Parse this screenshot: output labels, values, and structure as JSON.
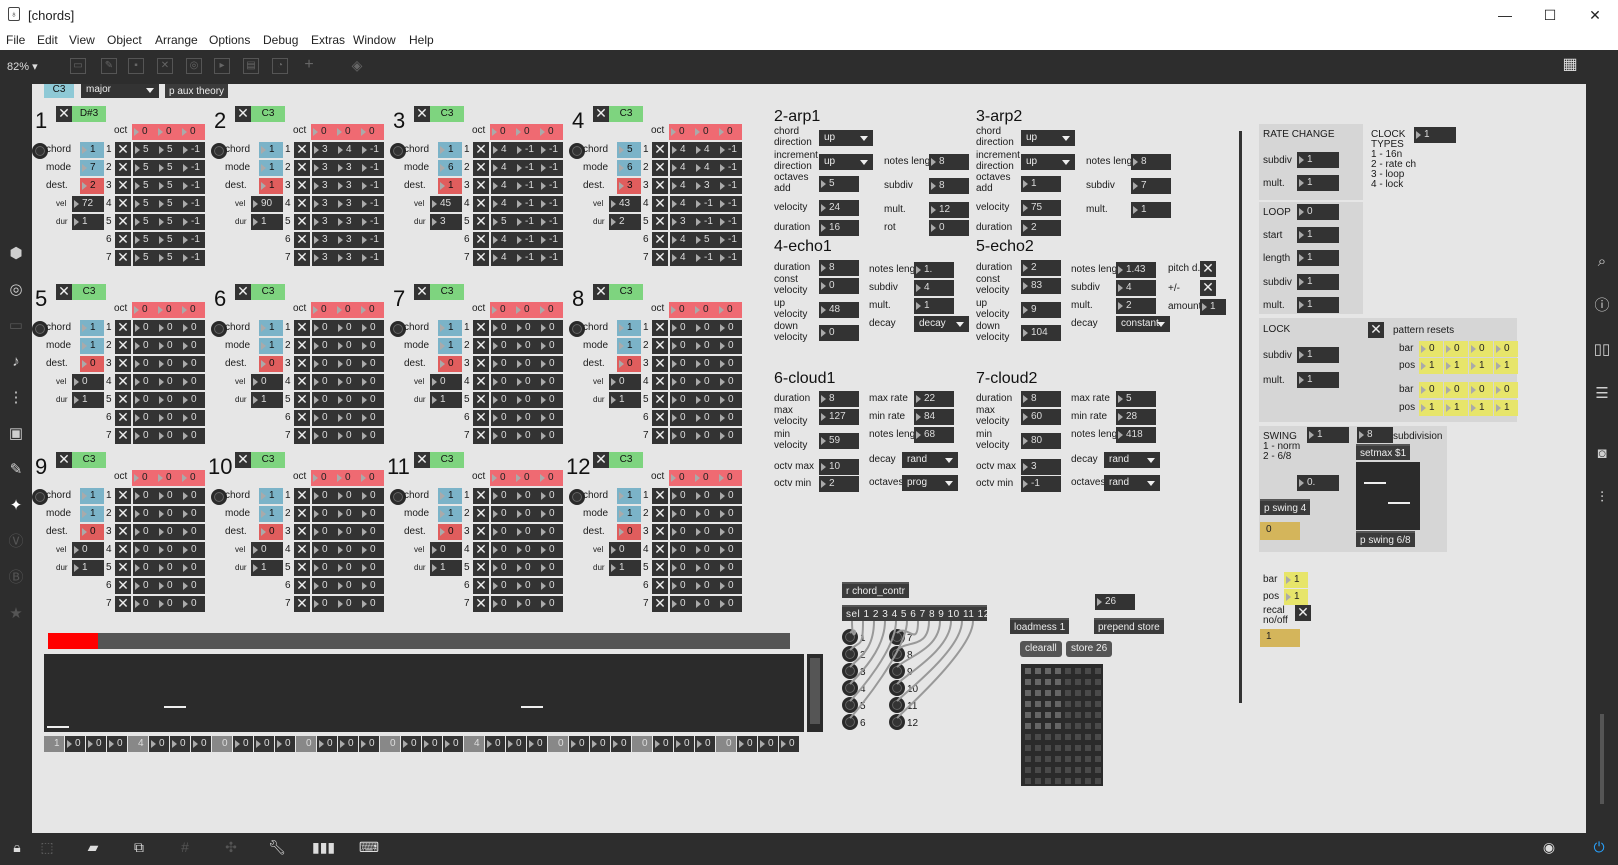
{
  "window": {
    "title": "[chords]",
    "app_icon": "max-icon",
    "minimize": "—",
    "maximize": "☐",
    "close": "✕"
  },
  "menu": [
    "File",
    "Edit",
    "View",
    "Object",
    "Arrange",
    "Options",
    "Debug",
    "Extras",
    "Window",
    "Help"
  ],
  "toolbar": {
    "zoom": "82%"
  },
  "top": {
    "root": "C3",
    "scale": "major",
    "patcher": "p aux theory"
  },
  "voices": [
    {
      "n": "1",
      "key": "D#3",
      "oct": [
        "0",
        "0",
        "0"
      ],
      "chord": "1",
      "mode": "7",
      "dest": "2",
      "vel": "72",
      "dur": "1",
      "rows": [
        [
          "5",
          "5",
          "-1"
        ],
        [
          "5",
          "5",
          "-1"
        ],
        [
          "5",
          "5",
          "-1"
        ],
        [
          "5",
          "5",
          "-1"
        ],
        [
          "5",
          "5",
          "-1"
        ],
        [
          "5",
          "5",
          "-1"
        ],
        [
          "5",
          "5",
          "-1"
        ]
      ]
    },
    {
      "n": "2",
      "key": "C3",
      "oct": [
        "0",
        "0",
        "0"
      ],
      "chord": "1",
      "mode": "1",
      "dest": "1",
      "vel": "90",
      "dur": "1",
      "rows": [
        [
          "3",
          "4",
          "-1"
        ],
        [
          "3",
          "3",
          "-1"
        ],
        [
          "3",
          "3",
          "-1"
        ],
        [
          "3",
          "3",
          "-1"
        ],
        [
          "3",
          "3",
          "-1"
        ],
        [
          "3",
          "3",
          "-1"
        ],
        [
          "3",
          "3",
          "-1"
        ]
      ]
    },
    {
      "n": "3",
      "key": "C3",
      "oct": [
        "0",
        "0",
        "0"
      ],
      "chord": "1",
      "mode": "6",
      "dest": "1",
      "vel": "45",
      "dur": "3",
      "rows": [
        [
          "4",
          "-1",
          "-1"
        ],
        [
          "4",
          "-1",
          "-1"
        ],
        [
          "4",
          "-1",
          "-1"
        ],
        [
          "4",
          "-1",
          "-1"
        ],
        [
          "5",
          "-1",
          "-1"
        ],
        [
          "4",
          "-1",
          "-1"
        ],
        [
          "4",
          "-1",
          "-1"
        ]
      ]
    },
    {
      "n": "4",
      "key": "C3",
      "oct": [
        "0",
        "0",
        "0"
      ],
      "chord": "5",
      "mode": "6",
      "dest": "3",
      "vel": "43",
      "dur": "2",
      "rows": [
        [
          "4",
          "4",
          "-1"
        ],
        [
          "4",
          "4",
          "-1"
        ],
        [
          "4",
          "3",
          "-1"
        ],
        [
          "4",
          "-1",
          "-1"
        ],
        [
          "3",
          "-1",
          "-1"
        ],
        [
          "4",
          "5",
          "-1"
        ],
        [
          "4",
          "-1",
          "-1"
        ]
      ]
    },
    {
      "n": "5",
      "key": "C3",
      "oct": [
        "0",
        "0",
        "0"
      ],
      "chord": "1",
      "mode": "1",
      "dest": "0",
      "vel": "0",
      "dur": "1",
      "rows": [
        [
          "0",
          "0",
          "0"
        ],
        [
          "0",
          "0",
          "0"
        ],
        [
          "0",
          "0",
          "0"
        ],
        [
          "0",
          "0",
          "0"
        ],
        [
          "0",
          "0",
          "0"
        ],
        [
          "0",
          "0",
          "0"
        ],
        [
          "0",
          "0",
          "0"
        ]
      ]
    },
    {
      "n": "6",
      "key": "C3",
      "oct": [
        "0",
        "0",
        "0"
      ],
      "chord": "1",
      "mode": "1",
      "dest": "0",
      "vel": "0",
      "dur": "1",
      "rows": [
        [
          "0",
          "0",
          "0"
        ],
        [
          "0",
          "0",
          "0"
        ],
        [
          "0",
          "0",
          "0"
        ],
        [
          "0",
          "0",
          "0"
        ],
        [
          "0",
          "0",
          "0"
        ],
        [
          "0",
          "0",
          "0"
        ],
        [
          "0",
          "0",
          "0"
        ]
      ]
    },
    {
      "n": "7",
      "key": "C3",
      "oct": [
        "0",
        "0",
        "0"
      ],
      "chord": "1",
      "mode": "1",
      "dest": "0",
      "vel": "0",
      "dur": "1",
      "rows": [
        [
          "0",
          "0",
          "0"
        ],
        [
          "0",
          "0",
          "0"
        ],
        [
          "0",
          "0",
          "0"
        ],
        [
          "0",
          "0",
          "0"
        ],
        [
          "0",
          "0",
          "0"
        ],
        [
          "0",
          "0",
          "0"
        ],
        [
          "0",
          "0",
          "0"
        ]
      ]
    },
    {
      "n": "8",
      "key": "C3",
      "oct": [
        "0",
        "0",
        "0"
      ],
      "chord": "1",
      "mode": "1",
      "dest": "0",
      "vel": "0",
      "dur": "1",
      "rows": [
        [
          "0",
          "0",
          "0"
        ],
        [
          "0",
          "0",
          "0"
        ],
        [
          "0",
          "0",
          "0"
        ],
        [
          "0",
          "0",
          "0"
        ],
        [
          "0",
          "0",
          "0"
        ],
        [
          "0",
          "0",
          "0"
        ],
        [
          "0",
          "0",
          "0"
        ]
      ]
    },
    {
      "n": "9",
      "key": "C3",
      "oct": [
        "0",
        "0",
        "0"
      ],
      "chord": "1",
      "mode": "1",
      "dest": "0",
      "vel": "0",
      "dur": "1",
      "rows": [
        [
          "0",
          "0",
          "0"
        ],
        [
          "0",
          "0",
          "0"
        ],
        [
          "0",
          "0",
          "0"
        ],
        [
          "0",
          "0",
          "0"
        ],
        [
          "0",
          "0",
          "0"
        ],
        [
          "0",
          "0",
          "0"
        ],
        [
          "0",
          "0",
          "0"
        ]
      ]
    },
    {
      "n": "10",
      "key": "C3",
      "oct": [
        "0",
        "0",
        "0"
      ],
      "chord": "1",
      "mode": "1",
      "dest": "0",
      "vel": "0",
      "dur": "1",
      "rows": [
        [
          "0",
          "0",
          "0"
        ],
        [
          "0",
          "0",
          "0"
        ],
        [
          "0",
          "0",
          "0"
        ],
        [
          "0",
          "0",
          "0"
        ],
        [
          "0",
          "0",
          "0"
        ],
        [
          "0",
          "0",
          "0"
        ],
        [
          "0",
          "0",
          "0"
        ]
      ]
    },
    {
      "n": "11",
      "key": "C3",
      "oct": [
        "0",
        "0",
        "0"
      ],
      "chord": "1",
      "mode": "1",
      "dest": "0",
      "vel": "0",
      "dur": "1",
      "rows": [
        [
          "0",
          "0",
          "0"
        ],
        [
          "0",
          "0",
          "0"
        ],
        [
          "0",
          "0",
          "0"
        ],
        [
          "0",
          "0",
          "0"
        ],
        [
          "0",
          "0",
          "0"
        ],
        [
          "0",
          "0",
          "0"
        ],
        [
          "0",
          "0",
          "0"
        ]
      ]
    },
    {
      "n": "12",
      "key": "C3",
      "oct": [
        "0",
        "0",
        "0"
      ],
      "chord": "1",
      "mode": "1",
      "dest": "0",
      "vel": "0",
      "dur": "1",
      "rows": [
        [
          "0",
          "0",
          "0"
        ],
        [
          "0",
          "0",
          "0"
        ],
        [
          "0",
          "0",
          "0"
        ],
        [
          "0",
          "0",
          "0"
        ],
        [
          "0",
          "0",
          "0"
        ],
        [
          "0",
          "0",
          "0"
        ],
        [
          "0",
          "0",
          "0"
        ]
      ]
    }
  ],
  "voice_labels": {
    "oct": "oct",
    "chord": "chord",
    "mode": "mode",
    "dest": "dest.",
    "vel": "vel",
    "dur": "dur",
    "rows": [
      "1",
      "2",
      "3",
      "4",
      "5",
      "6",
      "7"
    ]
  },
  "arp1": {
    "title": "2-arp1",
    "chord_direction_label": "chord\ndirection",
    "chord_direction": "up",
    "increment_direction_label": "increment\ndirection",
    "increment_direction": "up",
    "octaves_add_label": "octaves\nadd",
    "octaves_add": "5",
    "velocity_label": "velocity",
    "velocity": "24",
    "duration_label": "duration",
    "duration": "16",
    "notes_length_label": "notes leng",
    "notes_length": "8",
    "subdiv_label": "subdiv",
    "subdiv": "8",
    "mult_label": "mult.",
    "mult": "12",
    "rot_label": "rot",
    "rot": "0"
  },
  "arp2": {
    "title": "3-arp2",
    "chord_direction_label": "chord\ndirection",
    "chord_direction": "up",
    "increment_direction_label": "increment\ndirection",
    "increment_direction": "up",
    "octaves_add_label": "octaves\nadd",
    "octaves_add": "1",
    "velocity_label": "velocity",
    "velocity": "75",
    "duration_label": "duration",
    "duration": "2",
    "notes_length_label": "notes leng",
    "notes_length": "8",
    "subdiv_label": "subdiv",
    "subdiv": "7",
    "mult_label": "mult.",
    "mult": "1"
  },
  "echo1": {
    "title": "4-echo1",
    "duration_label": "duration",
    "duration": "8",
    "const_velocity_label": "const\nvelocity",
    "const_velocity": "0",
    "up_velocity_label": "up\nvelocity",
    "up_velocity": "48",
    "down_velocity_label": "down\nvelocity",
    "down_velocity": "0",
    "notes_length_label": "notes leng",
    "notes_length": "1.",
    "subdiv_label": "subdiv",
    "subdiv": "4",
    "mult_label": "mult.",
    "mult": "1",
    "decay_label": "decay",
    "decay": "decay"
  },
  "echo2": {
    "title": "5-echo2",
    "duration_label": "duration",
    "duration": "2",
    "const_velocity_label": "const\nvelocity",
    "const_velocity": "83",
    "up_velocity_label": "up\nvelocity",
    "up_velocity": "9",
    "down_velocity_label": "down\nvelocity",
    "down_velocity": "104",
    "notes_length_label": "notes leng",
    "notes_length": "1.43",
    "subdiv_label": "subdiv",
    "subdiv": "4",
    "mult_label": "mult.",
    "mult": "2",
    "decay_label": "decay",
    "decay": "constant",
    "pitch_label": "pitch d.",
    "plusminus_label": "+/-",
    "amount_label": "amount",
    "amount": "1"
  },
  "cloud1": {
    "title": "6-cloud1",
    "duration_label": "duration",
    "duration": "8",
    "max_velocity_label": "max\nvelocity",
    "max_velocity": "127",
    "min_velocity_label": "min\nvelocity",
    "min_velocity": "59",
    "octv_max_label": "octv max",
    "octv_max": "10",
    "octv_min_label": "octv min",
    "octv_min": "2",
    "max_rate_label": "max rate",
    "max_rate": "22",
    "min_rate_label": "min rate",
    "min_rate": "84",
    "notes_length_label": "notes leng",
    "notes_length": "68",
    "decay_label": "decay",
    "decay": "rand",
    "octaves_label": "octaves",
    "octaves": "prog"
  },
  "cloud2": {
    "title": "7-cloud2",
    "duration_label": "duration",
    "duration": "8",
    "max_velocity_label": "max\nvelocity",
    "max_velocity": "60",
    "min_velocity_label": "min\nvelocity",
    "min_velocity": "80",
    "octv_max_label": "octv max",
    "octv_max": "3",
    "octv_min_label": "octv min",
    "octv_min": "-1",
    "max_rate_label": "max rate",
    "max_rate": "5",
    "min_rate_label": "min rate",
    "min_rate": "28",
    "notes_length_label": "notes leng",
    "notes_length": "418",
    "decay_label": "decay",
    "decay": "rand",
    "octaves_label": "octaves",
    "octaves": "rand"
  },
  "right": {
    "rate_change": "RATE CHANGE",
    "subdiv_label": "subdiv",
    "mult_label": "mult.",
    "rc_subdiv": "1",
    "rc_mult": "1",
    "clock_label": "CLOCK",
    "clock": "1",
    "clock_types": "TYPES\n1 - 16n\n2 - rate ch\n3 - loop\n4 - lock",
    "loop_label": "LOOP",
    "loop": "0",
    "start_label": "start",
    "start": "1",
    "length_label": "length",
    "length": "1",
    "loop_subdiv": "1",
    "loop_mult": "1",
    "lock_label": "LOCK",
    "lock_subdiv": "1",
    "lock_mult": "1",
    "pattern_resets": "pattern resets",
    "bar_label": "bar",
    "pos_label": "pos",
    "bar1": [
      "0",
      "0",
      "0",
      "0"
    ],
    "pos1": [
      "1",
      "1",
      "1",
      "1"
    ],
    "bar2": [
      "0",
      "0",
      "0",
      "0"
    ],
    "pos2": [
      "1",
      "1",
      "1",
      "1"
    ],
    "swing_label": "SWING",
    "swing": "1",
    "swing_types": "1 - norm\n2 - 6/8",
    "subdivision_label": "subdivision",
    "subdivision": "8",
    "setmax": "setmax $1",
    "swing_val": "0.",
    "pswing4": "p swing 4",
    "pswing68": "p swing 6/8",
    "swing_out": "0",
    "bar_val": "1",
    "pos_val": "1",
    "recal_label": "recal\nno/off",
    "recal_out": "1"
  },
  "middle": {
    "receive": "r chord_contr",
    "sel": "sel 1 2 3 4 5 6 7 8 9 10 11 12",
    "outs_left": [
      "1",
      "2",
      "3",
      "4",
      "5",
      "6"
    ],
    "outs_right": [
      "7",
      "8",
      "9",
      "10",
      "11",
      "12"
    ],
    "loadmess": "loadmess 1",
    "prepend": "prepend store",
    "clearall": "clearall",
    "store": "store 26",
    "counter": "26"
  },
  "seq": {
    "cells": [
      "1",
      "0",
      "0",
      "0",
      "4",
      "0",
      "0",
      "0",
      "0",
      "0",
      "0",
      "0",
      "0",
      "0",
      "0",
      "0",
      "0",
      "0",
      "0",
      "0",
      "4",
      "0",
      "0",
      "0",
      "0",
      "0",
      "0",
      "0",
      "0",
      "0",
      "0",
      "0",
      "0",
      "0",
      "0",
      "0"
    ]
  }
}
